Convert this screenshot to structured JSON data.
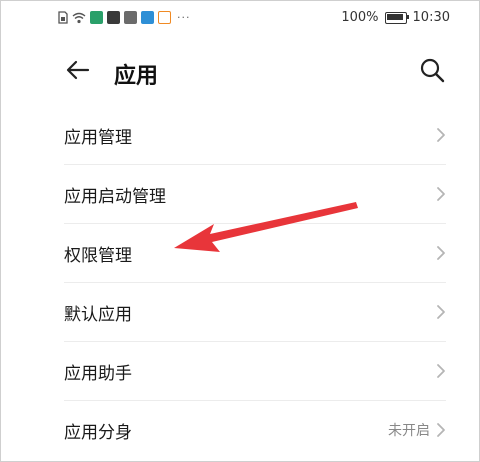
{
  "status_bar": {
    "battery_percent": "100%",
    "time": "10:30",
    "icons": [
      "sim-icon",
      "wifi-icon",
      "app-icon-1",
      "app-icon-2",
      "app-icon-3",
      "app-icon-4",
      "app-icon-5"
    ],
    "dots": "···"
  },
  "header": {
    "title": "应用",
    "back_icon": "arrow-left",
    "search_icon": "magnifier"
  },
  "list": {
    "items": [
      {
        "label": "应用管理",
        "value": ""
      },
      {
        "label": "应用启动管理",
        "value": ""
      },
      {
        "label": "权限管理",
        "value": ""
      },
      {
        "label": "默认应用",
        "value": ""
      },
      {
        "label": "应用助手",
        "value": ""
      },
      {
        "label": "应用分身",
        "value": "未开启"
      }
    ]
  },
  "annotation": {
    "arrow_color": "#e8353a",
    "points_to": "权限管理"
  },
  "colors": {
    "chevron": "#b5b5b5",
    "divider": "#ececec",
    "value_text": "#888888"
  }
}
